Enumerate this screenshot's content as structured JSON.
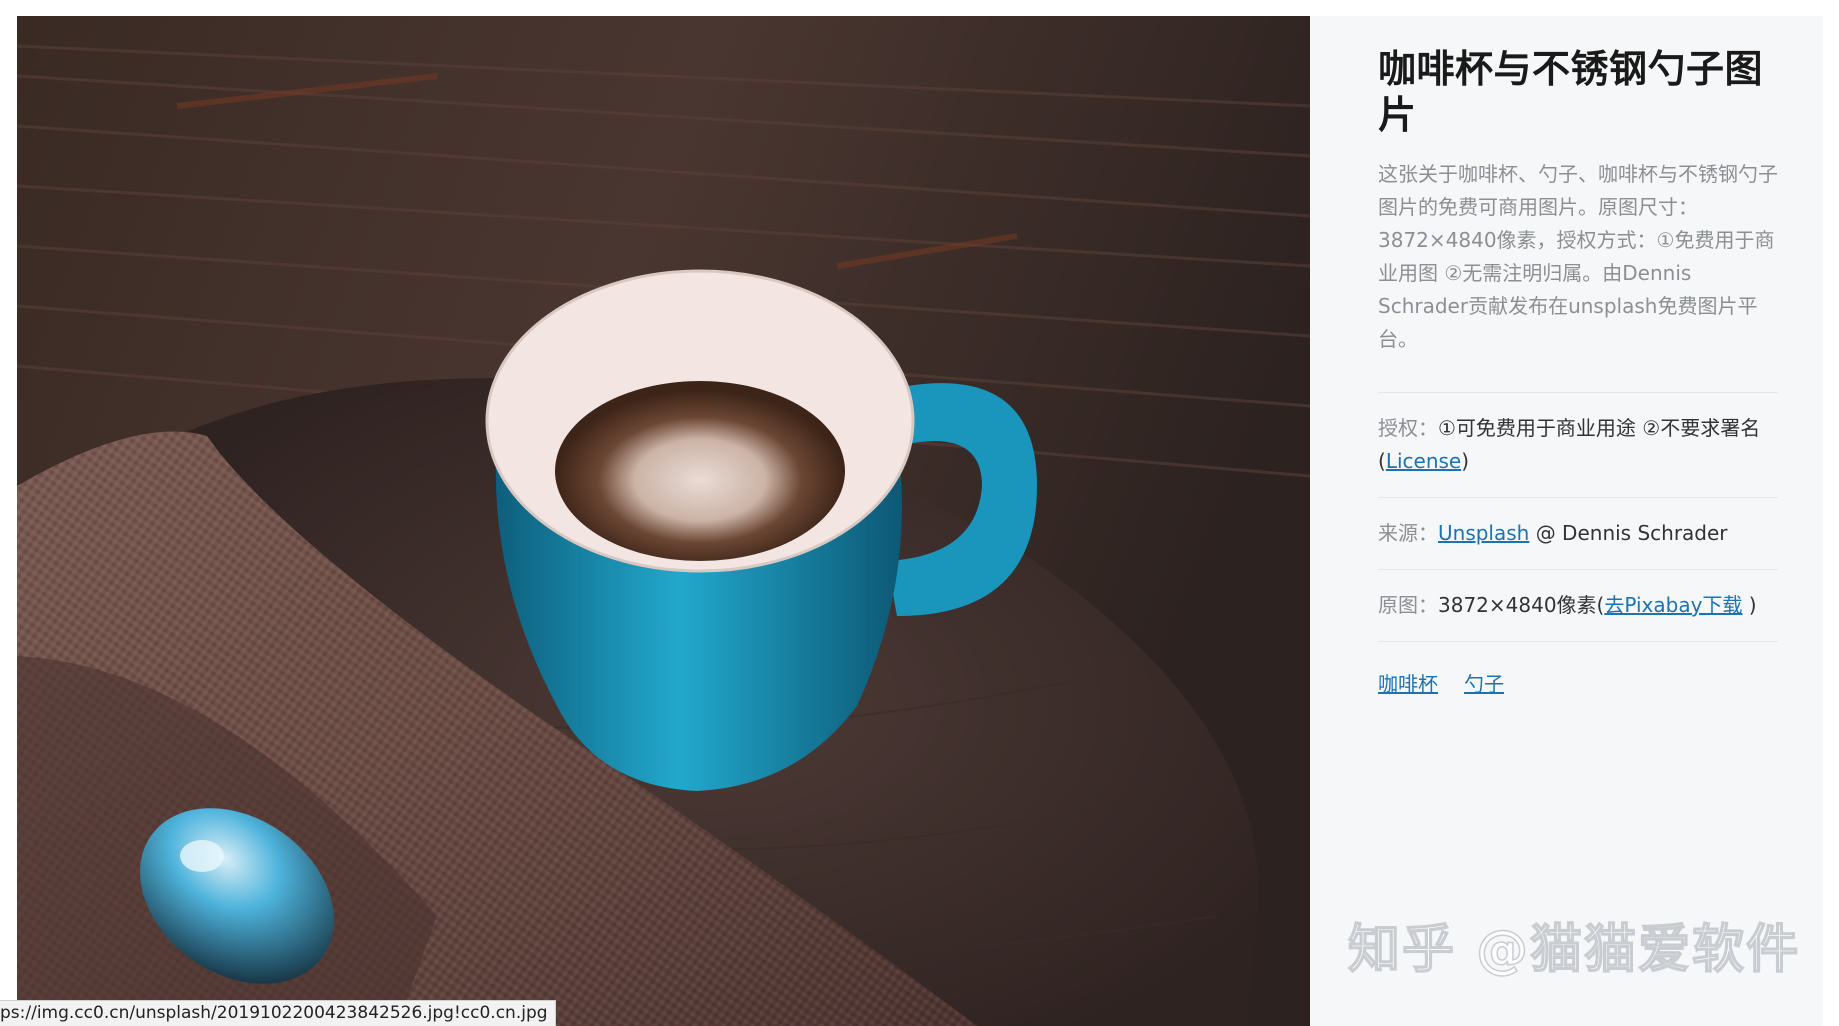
{
  "panel": {
    "title": "咖啡杯与不锈钢勺子图片",
    "description": "这张关于咖啡杯、勺子、咖啡杯与不锈钢勺子图片的免费可商用图片。原图尺寸：3872×4840像素，授权方式：①免费用于商业用图 ②无需注明归属。由Dennis Schrader贡献发布在unsplash免费图片平台。",
    "license": {
      "label": "授权：",
      "text": "①可免费用于商业用途 ②不要求署名 (",
      "link": "License",
      "close": ")"
    },
    "source": {
      "label": "来源：",
      "link": "Unsplash",
      "author": " @ Dennis Schrader"
    },
    "original": {
      "label": "原图：",
      "size": "3872×4840像素(",
      "link": "去Pixabay下载",
      "close": " )"
    },
    "tags": [
      "咖啡杯",
      "勺子"
    ]
  },
  "watermark": "知乎 @猫猫爱软件",
  "status_url": "ps://img.cc0.cn/unsplash/20191022004238425​26.jpg!cc0.cn.jpg",
  "colors": {
    "link": "#1a73b4",
    "panel_bg": "#f5f7f9",
    "muted": "#8c8f94",
    "cup_blue": "#1f9fc4"
  }
}
